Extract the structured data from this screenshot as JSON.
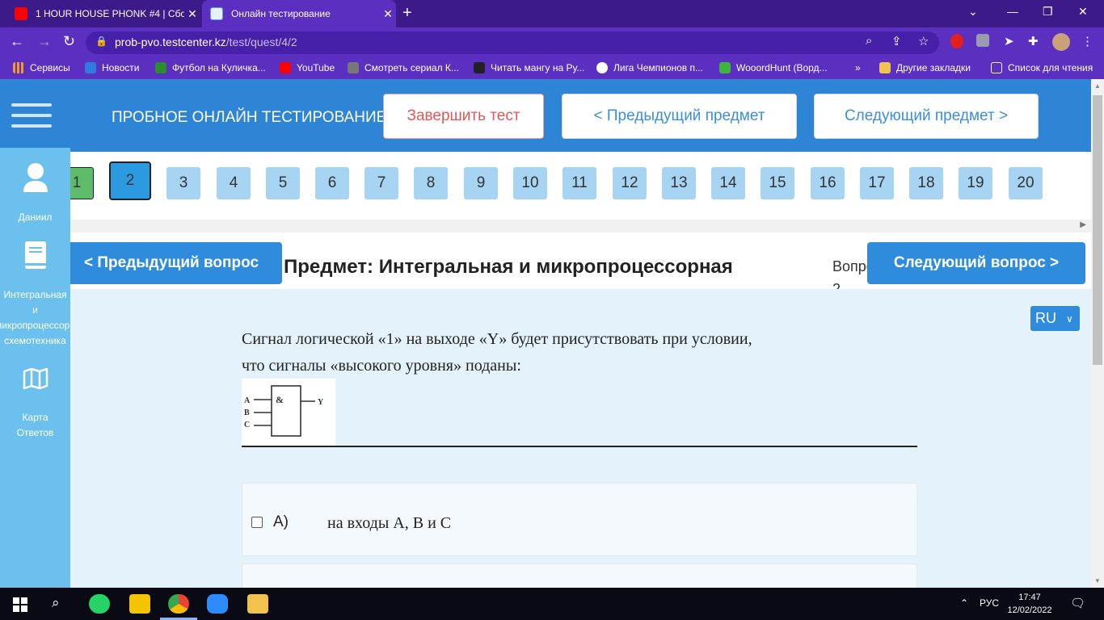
{
  "browser": {
    "tabs": [
      {
        "title": "1 HOUR HOUSE PHONK #4 | Сбо",
        "favicon": "youtube-icon"
      },
      {
        "title": "Онлайн тестирование",
        "favicon": "testcenter-icon"
      }
    ],
    "url_host": "prob-pvo.testcenter.kz",
    "url_path": "/test/quest/4/2",
    "bookmarks": [
      {
        "label": "Сервисы",
        "icon": "apps-grid-icon"
      },
      {
        "label": "Новости",
        "icon": "news-icon"
      },
      {
        "label": "Футбол на Куличка...",
        "icon": "football-icon"
      },
      {
        "label": "YouTube",
        "icon": "youtube-icon"
      },
      {
        "label": "Смотреть сериал К...",
        "icon": "hd-icon"
      },
      {
        "label": "Читать мангу на Ру...",
        "icon": "manga-icon"
      },
      {
        "label": "Лига Чемпионов п...",
        "icon": "champions-icon"
      },
      {
        "label": "WooordHunt (Ворд...",
        "icon": "wooordhunt-icon"
      }
    ],
    "other_bookmarks": "Другие закладки",
    "reading_list": "Список для чтения"
  },
  "header": {
    "title": "ПРОБНОЕ ОНЛАЙН ТЕСТИРОВАНИЕ",
    "finish_button": "Завершить тест",
    "prev_subject_button": "< Предыдущий предмет",
    "next_subject_button": "Следующий предмет >"
  },
  "sidebar": {
    "user_name": "Даниил",
    "subject_line1": "Интегральная",
    "subject_line2": "и",
    "subject_line3": "микропроцессорная",
    "subject_line4": "схемотехника",
    "map_line1": "Карта",
    "map_line2": "Ответов"
  },
  "questions": {
    "numbers": [
      "1",
      "2",
      "3",
      "4",
      "5",
      "6",
      "7",
      "8",
      "9",
      "10",
      "11",
      "12",
      "13",
      "14",
      "15",
      "16",
      "17",
      "18",
      "19",
      "20"
    ],
    "current": "2",
    "answered": [
      "1"
    ]
  },
  "subject_bar": {
    "subject_text": "Предмет: Интегральная и микропроцессорная",
    "question_counter_line1": "Вопрос",
    "question_counter_line2": "2",
    "prev_question_button": "< Предыдущий вопрос",
    "next_question_button": "Следующий вопрос >"
  },
  "language": {
    "selected": "RU"
  },
  "question": {
    "text_line1": "Сигнал логической «1» на выходе «Y» будет присутствовать при условии,",
    "text_line2": "что сигналы «высокого уровня» поданы:",
    "circuit": {
      "gate": "&",
      "inputs": [
        "A",
        "B",
        "C"
      ],
      "output": "Y"
    }
  },
  "answers": [
    {
      "label": "A)",
      "text": "на входы А, В и С"
    }
  ],
  "taskbar": {
    "language": "РУС",
    "time": "17:47",
    "date": "12/02/2022"
  },
  "colors": {
    "browser_frame": "#5b2fc0",
    "header": "#2e84d5",
    "sidebar": "#6cc0ee",
    "content_bg": "#e3f2fb",
    "accent": "#2f8bdc",
    "finish": "#e05757"
  }
}
